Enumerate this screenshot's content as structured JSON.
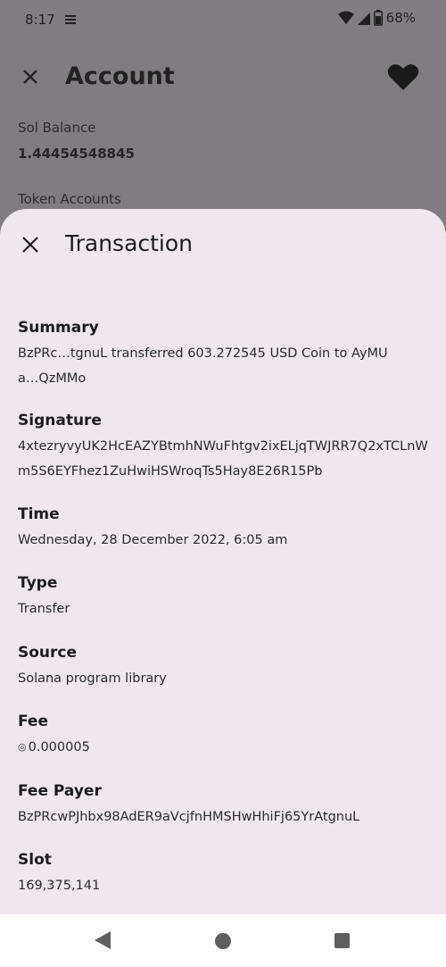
{
  "status_bar": {
    "time": "8:17",
    "battery": "68%",
    "icons": [
      "notification-icon",
      "wifi-icon",
      "signal-icon",
      "battery-icon"
    ]
  },
  "background_screen": {
    "title": "Account",
    "label_1": "Sol Balance",
    "value_1": "1.44454548845",
    "label_2": "Token Accounts"
  },
  "sheet": {
    "title": "Transaction",
    "fields": {
      "summary": {
        "label": "Summary",
        "value": "BzPRc…tgnuL transferred 603.272545 USD Coin to AyMUa…QzMMo"
      },
      "signature": {
        "label": "Signature",
        "value": "4xtezryvyUK2HcEAZYBtmhNWuFhtgv2ixELjqTWJRR7Q2xTCLnWm5S6EYFhez1ZuHwiHSWroqTs5Hay8E26R15Pb"
      },
      "time": {
        "label": "Time",
        "value": "Wednesday, 28 December 2022, 6:05 am"
      },
      "type": {
        "label": "Type",
        "value": "Transfer"
      },
      "source": {
        "label": "Source",
        "value": "Solana program library"
      },
      "fee": {
        "label": "Fee",
        "symbol": "◎",
        "value": "0.000005"
      },
      "fee_payer": {
        "label": "Fee Payer",
        "value": "BzPRcwPJhbx98AdER9aVcjfnHMSHwHhiFj65YrAtgnuL"
      },
      "slot": {
        "label": "Slot",
        "value": "169,375,141"
      }
    }
  },
  "colors": {
    "sheet_background": "#eee8ee",
    "scrim": "#807d80",
    "text_primary": "#1c1b1f"
  }
}
